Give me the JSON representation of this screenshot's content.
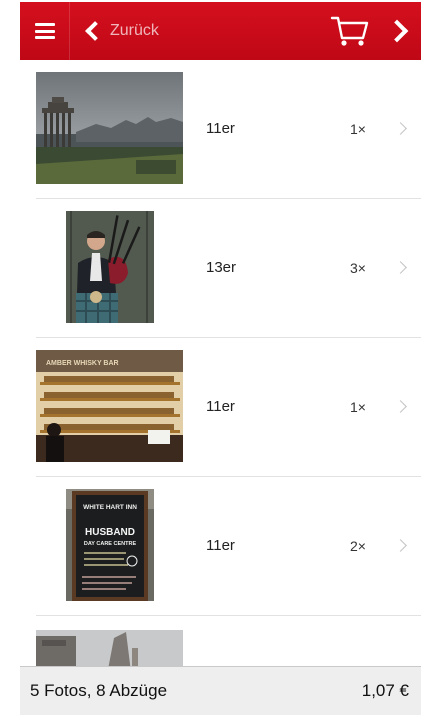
{
  "navbar": {
    "back_label": "Zurück",
    "color": "#c80a18"
  },
  "items": [
    {
      "format": "11er",
      "quantity": "1×",
      "photo": "edinburgh-skyline-photo"
    },
    {
      "format": "13er",
      "quantity": "3×",
      "photo": "bagpiper-photo"
    },
    {
      "format": "11er",
      "quantity": "1×",
      "photo": "whisky-bar-photo"
    },
    {
      "format": "11er",
      "quantity": "2×",
      "photo": "pub-chalkboard-photo"
    }
  ],
  "chalkboard": {
    "line1": "WHITE HART INN",
    "line2": "HUSBAND",
    "line3": "DAY CARE CENTRE"
  },
  "bar_sign": "AMBER WHISKY BAR",
  "footer": {
    "summary": "5 Fotos, 8 Abzüge",
    "total": "1,07 €"
  }
}
